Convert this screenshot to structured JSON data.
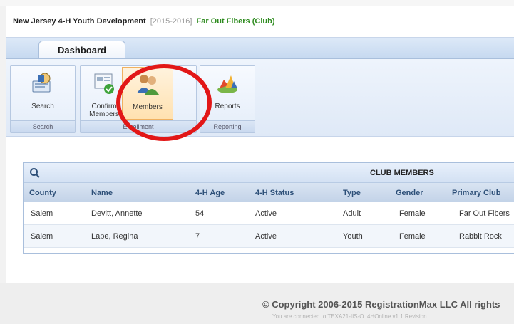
{
  "header": {
    "org": "New Jersey 4-H Youth Development",
    "year": "[2015-2016]",
    "club": "Far Out Fibers (Club)"
  },
  "tabs": [
    {
      "label": "Dashboard"
    }
  ],
  "ribbon": {
    "groups": [
      {
        "label": "Search",
        "buttons": [
          {
            "label": "Search",
            "icon": "search-icon"
          }
        ]
      },
      {
        "label": "Enrollment",
        "buttons": [
          {
            "label": "Confirm Members",
            "icon": "confirm-members-icon"
          },
          {
            "label": "Members",
            "icon": "members-icon"
          }
        ]
      },
      {
        "label": "Reporting",
        "buttons": [
          {
            "label": "Reports",
            "icon": "reports-icon"
          }
        ]
      }
    ],
    "enrollment_label_visible": "Enrollment",
    "confirm_line1": "Confirm",
    "confirm_line2": "Members"
  },
  "table": {
    "title": "CLUB MEMBERS",
    "columns": [
      "County",
      "Name",
      "4-H Age",
      "4-H Status",
      "Type",
      "Gender",
      "Primary Club"
    ],
    "rows": [
      [
        "Salem",
        "Devitt, Annette",
        "54",
        "Active",
        "Adult",
        "Female",
        "Far Out Fibers"
      ],
      [
        "Salem",
        "Lape, Regina",
        "7",
        "Active",
        "Youth",
        "Female",
        "Rabbit Rock"
      ]
    ]
  },
  "footer": {
    "copyright": "© Copyright 2006-2015 RegistrationMax LLC All rights",
    "connected": "You are connected to TEXA21-IIS-O. 4HOnline v1.1 Revision"
  },
  "colors": {
    "accent_red": "#e21717",
    "club_green": "#2e8b1f",
    "header_blue": "#2d4f78"
  }
}
